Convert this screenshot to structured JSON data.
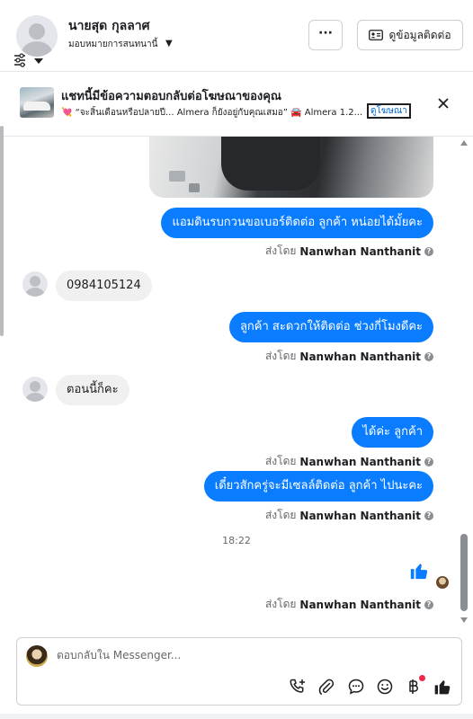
{
  "header": {
    "name": "นายสุด กุลลาศ",
    "subtitle": "มอบหมายการสนทนานี้",
    "more_label": "···",
    "contact_label": "ดูข้อมูลติดต่อ"
  },
  "banner": {
    "title": "แชทนี้มีข้อความตอบกลับต่อโฆษณาของคุณ",
    "text": "💘 “จะสิ้นเดือนหรือปลายปี... Almera ก็ยังอยู่กับคุณเสมอ” 🚘 Almera 1.2...",
    "link": "ดูโฆษณา"
  },
  "messages": [
    {
      "dir": "out",
      "text": "แอมดินรบกวนขอเบอร์ติดต่อ ลูกค้า หน่อยได้มั้ยคะ"
    },
    {
      "dir": "in",
      "text": "0984105124"
    },
    {
      "dir": "out",
      "text": "ลูกค้า สะดวกให้ติดต่อ ช่วงกี่โมงดีคะ"
    },
    {
      "dir": "in",
      "text": "ตอนนี้ก็คะ"
    },
    {
      "dir": "out",
      "text": "ได้ค่ะ  ลูกค้า"
    },
    {
      "dir": "out",
      "text": "เดี๋ยวสักครู่จะมีเซลล์ติดต่อ ลูกค้า ไปนะคะ"
    }
  ],
  "sent_by": {
    "prefix": "ส่งโดย",
    "sender": "Nanwhan Nanthanit",
    "info": "?"
  },
  "timestamp": "18:22",
  "composer": {
    "placeholder": "ตอบกลับใน Messenger..."
  },
  "colors": {
    "accent": "#0a7cff",
    "incoming_bubble": "#f0f0f0",
    "notification": "#f02849"
  },
  "icons": {
    "filter": "sliders-icon",
    "more": "more-icon",
    "contact": "contact-card-icon",
    "close": "close-icon",
    "like": "thumbs-up-icon",
    "call": "call-add-icon",
    "attach": "paperclip-icon",
    "saved_reply": "chat-bubble-icon",
    "emoji": "emoji-icon",
    "payment": "baht-icon",
    "send_like": "thumbs-up-icon"
  }
}
